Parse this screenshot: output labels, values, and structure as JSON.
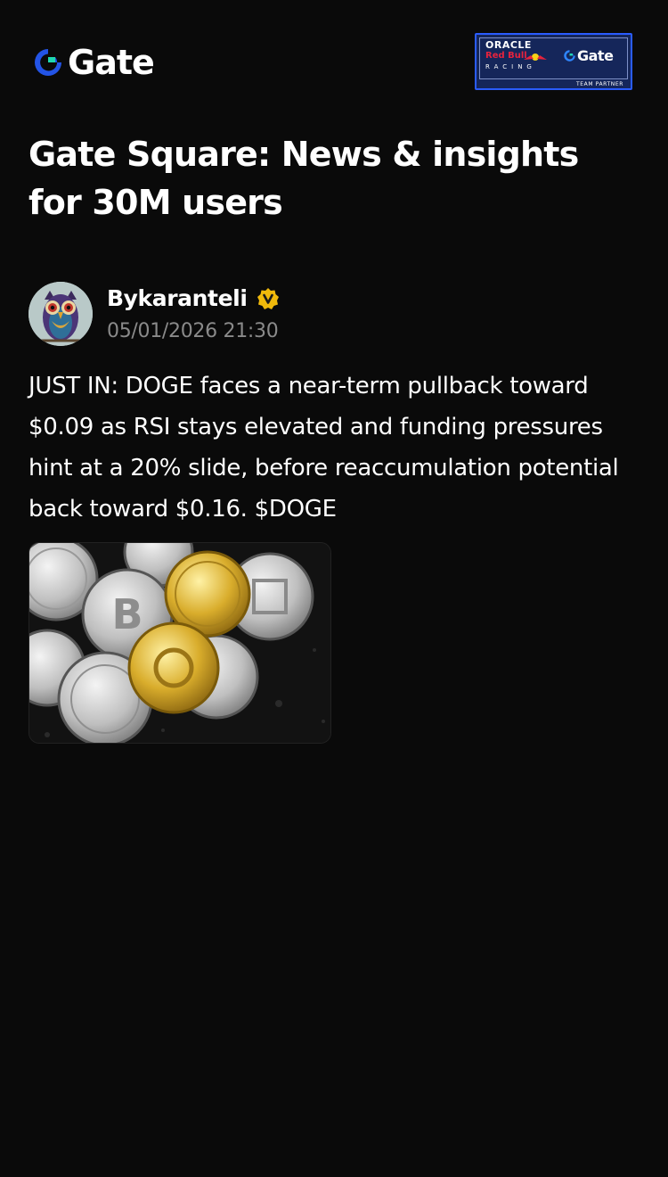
{
  "header": {
    "logo": {
      "text": "Gate",
      "icon": "gate-logo-icon",
      "accent": "#2354e6",
      "mark_color": "#1fd8b0"
    },
    "partner_badge": {
      "oracle": "ORACLE",
      "redbull": "Red Bull",
      "racing": "RACING",
      "gate": "Gate",
      "team_partner": "TEAM PARTNER",
      "bg": "#15265a",
      "border": "#2a5cff"
    }
  },
  "page_title": "Gate Square: News & insights for 30M users",
  "post": {
    "author": {
      "name": "Bykaranteli",
      "verified": true,
      "verified_color": "#f0b90b",
      "avatar_icon": "owl-avatar"
    },
    "timestamp": "05/01/2026 21:30",
    "text": "JUST IN: DOGE faces a near-term pullback toward $0.09 as RSI stays elevated and funding pressures hint at a 20% slide, before reaccumulation potential back toward $0.16. $DOGE",
    "image": {
      "description_icon": "crypto-coins-image"
    }
  }
}
